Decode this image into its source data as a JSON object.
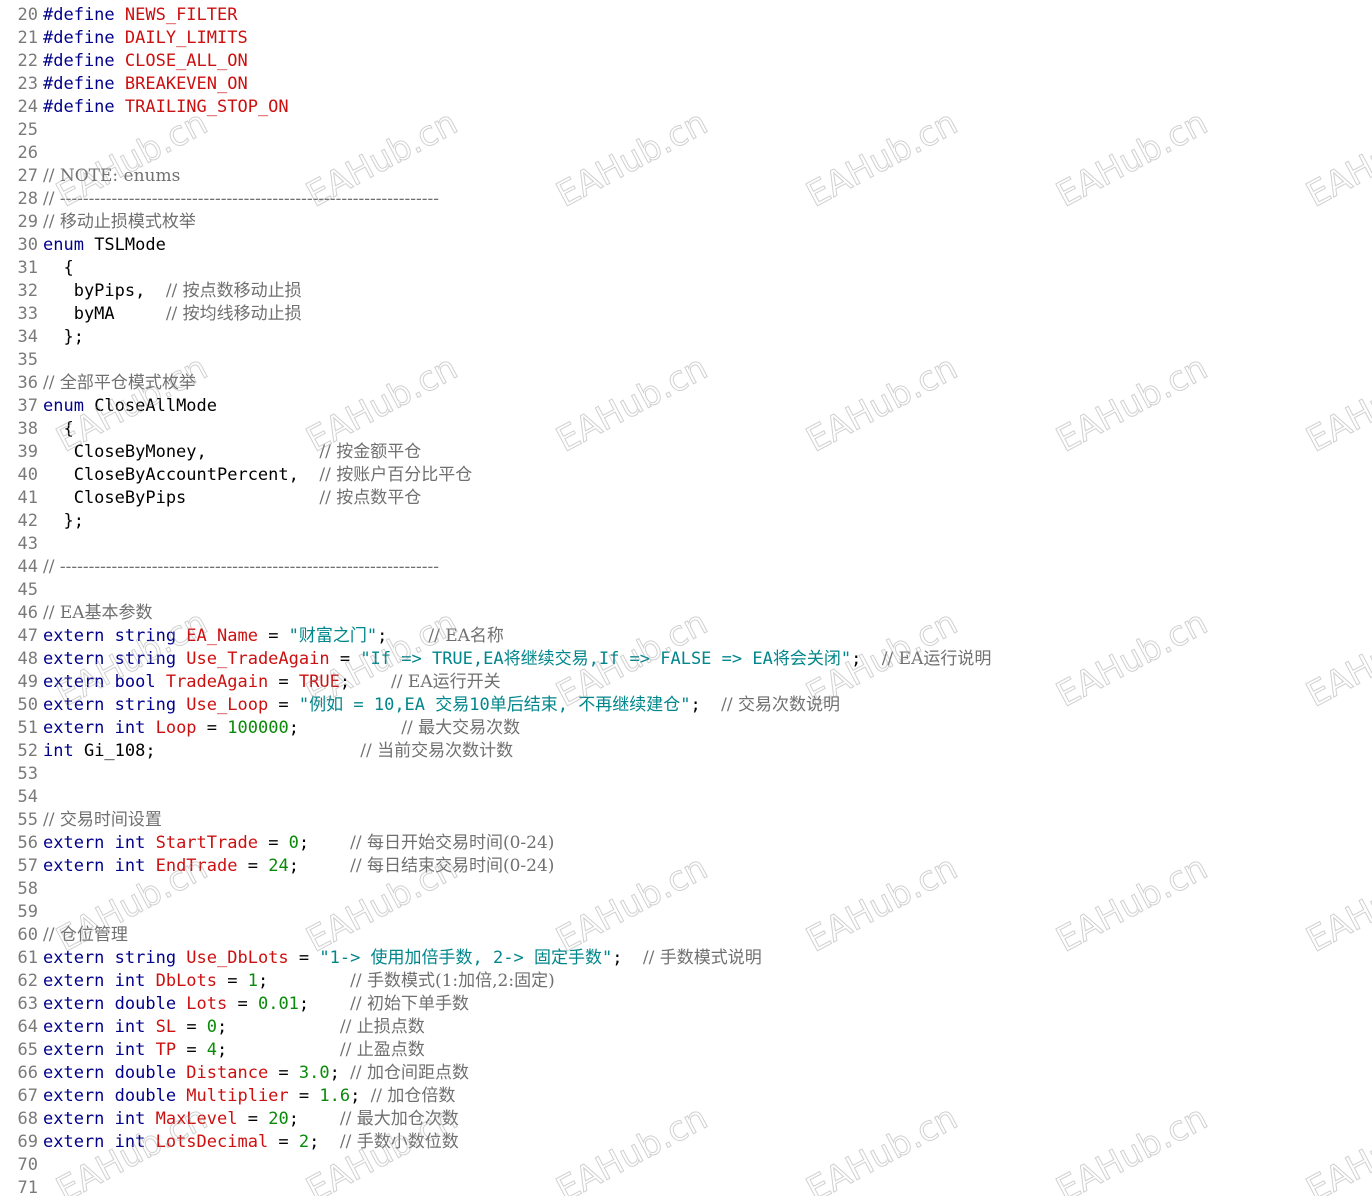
{
  "editor": {
    "lines": [
      {
        "num": "20",
        "tokens": [
          {
            "t": "kw",
            "s": "#define "
          },
          {
            "t": "id",
            "s": "NEWS_FILTER"
          }
        ]
      },
      {
        "num": "21",
        "tokens": [
          {
            "t": "kw",
            "s": "#define "
          },
          {
            "t": "id",
            "s": "DAILY_LIMITS"
          }
        ]
      },
      {
        "num": "22",
        "tokens": [
          {
            "t": "kw",
            "s": "#define "
          },
          {
            "t": "id",
            "s": "CLOSE_ALL_ON"
          }
        ]
      },
      {
        "num": "23",
        "tokens": [
          {
            "t": "kw",
            "s": "#define "
          },
          {
            "t": "id",
            "s": "BREAKEVEN_ON"
          }
        ]
      },
      {
        "num": "24",
        "tokens": [
          {
            "t": "kw",
            "s": "#define "
          },
          {
            "t": "id",
            "s": "TRAILING_STOP_ON"
          }
        ]
      },
      {
        "num": "25",
        "tokens": []
      },
      {
        "num": "26",
        "tokens": []
      },
      {
        "num": "27",
        "tokens": [
          {
            "t": "cmt",
            "s": "// NOTE: enums"
          }
        ]
      },
      {
        "num": "28",
        "tokens": [
          {
            "t": "cmt",
            "s": "// ------------------------------------------------------------------"
          }
        ]
      },
      {
        "num": "29",
        "tokens": [
          {
            "t": "cmt",
            "s": "// 移动止损模式枚举"
          }
        ]
      },
      {
        "num": "30",
        "tokens": [
          {
            "t": "kw",
            "s": "enum "
          },
          {
            "t": "plain",
            "s": "TSLMode"
          }
        ]
      },
      {
        "num": "31",
        "tokens": [
          {
            "t": "plain",
            "s": "  {"
          }
        ]
      },
      {
        "num": "32",
        "tokens": [
          {
            "t": "plain",
            "s": "   byPips,  "
          },
          {
            "t": "cmt",
            "s": "// 按点数移动止损"
          }
        ]
      },
      {
        "num": "33",
        "tokens": [
          {
            "t": "plain",
            "s": "   byMA     "
          },
          {
            "t": "cmt",
            "s": "// 按均线移动止损"
          }
        ]
      },
      {
        "num": "34",
        "tokens": [
          {
            "t": "plain",
            "s": "  };"
          }
        ]
      },
      {
        "num": "35",
        "tokens": []
      },
      {
        "num": "36",
        "tokens": [
          {
            "t": "cmt",
            "s": "// 全部平仓模式枚举"
          }
        ]
      },
      {
        "num": "37",
        "tokens": [
          {
            "t": "kw",
            "s": "enum "
          },
          {
            "t": "plain",
            "s": "CloseAllMode"
          }
        ]
      },
      {
        "num": "38",
        "tokens": [
          {
            "t": "plain",
            "s": "  {"
          }
        ]
      },
      {
        "num": "39",
        "tokens": [
          {
            "t": "plain",
            "s": "   CloseByMoney,           "
          },
          {
            "t": "cmt",
            "s": "// 按金额平仓"
          }
        ]
      },
      {
        "num": "40",
        "tokens": [
          {
            "t": "plain",
            "s": "   CloseByAccountPercent,  "
          },
          {
            "t": "cmt",
            "s": "// 按账户百分比平仓"
          }
        ]
      },
      {
        "num": "41",
        "tokens": [
          {
            "t": "plain",
            "s": "   CloseByPips             "
          },
          {
            "t": "cmt",
            "s": "// 按点数平仓"
          }
        ]
      },
      {
        "num": "42",
        "tokens": [
          {
            "t": "plain",
            "s": "  };"
          }
        ]
      },
      {
        "num": "43",
        "tokens": []
      },
      {
        "num": "44",
        "tokens": [
          {
            "t": "cmt",
            "s": "// ------------------------------------------------------------------"
          }
        ]
      },
      {
        "num": "45",
        "tokens": []
      },
      {
        "num": "46",
        "tokens": [
          {
            "t": "cmt",
            "s": "// EA基本参数"
          }
        ]
      },
      {
        "num": "47",
        "tokens": [
          {
            "t": "kw",
            "s": "extern string "
          },
          {
            "t": "id",
            "s": "EA_Name"
          },
          {
            "t": "plain",
            "s": " = "
          },
          {
            "t": "str",
            "s": "\"财富之门\""
          },
          {
            "t": "plain",
            "s": ";    "
          },
          {
            "t": "cmt",
            "s": "// EA名称"
          }
        ]
      },
      {
        "num": "48",
        "tokens": [
          {
            "t": "kw",
            "s": "extern string "
          },
          {
            "t": "id",
            "s": "Use_TradeAgain"
          },
          {
            "t": "plain",
            "s": " = "
          },
          {
            "t": "str",
            "s": "\"If => TRUE,EA将继续交易,If => FALSE => EA将会关闭\""
          },
          {
            "t": "plain",
            "s": ";  "
          },
          {
            "t": "cmt",
            "s": "// EA运行说明"
          }
        ]
      },
      {
        "num": "49",
        "tokens": [
          {
            "t": "kw",
            "s": "extern bool "
          },
          {
            "t": "id",
            "s": "TradeAgain"
          },
          {
            "t": "plain",
            "s": " = "
          },
          {
            "t": "id",
            "s": "TRUE"
          },
          {
            "t": "plain",
            "s": ";    "
          },
          {
            "t": "cmt",
            "s": "// EA运行开关"
          }
        ]
      },
      {
        "num": "50",
        "tokens": [
          {
            "t": "kw",
            "s": "extern string "
          },
          {
            "t": "id",
            "s": "Use_Loop"
          },
          {
            "t": "plain",
            "s": " = "
          },
          {
            "t": "str",
            "s": "\"例如 = 10,EA 交易10单后结束, 不再继续建仓\""
          },
          {
            "t": "plain",
            "s": ";  "
          },
          {
            "t": "cmt",
            "s": "// 交易次数说明"
          }
        ]
      },
      {
        "num": "51",
        "tokens": [
          {
            "t": "kw",
            "s": "extern int "
          },
          {
            "t": "id",
            "s": "Loop"
          },
          {
            "t": "plain",
            "s": " = "
          },
          {
            "t": "num",
            "s": "100000"
          },
          {
            "t": "plain",
            "s": ";          "
          },
          {
            "t": "cmt",
            "s": "// 最大交易次数"
          }
        ]
      },
      {
        "num": "52",
        "tokens": [
          {
            "t": "kw",
            "s": "int "
          },
          {
            "t": "plain",
            "s": "Gi_108;                    "
          },
          {
            "t": "cmt",
            "s": "// 当前交易次数计数"
          }
        ]
      },
      {
        "num": "53",
        "tokens": []
      },
      {
        "num": "54",
        "tokens": []
      },
      {
        "num": "55",
        "tokens": [
          {
            "t": "cmt",
            "s": "// 交易时间设置"
          }
        ]
      },
      {
        "num": "56",
        "tokens": [
          {
            "t": "kw",
            "s": "extern int "
          },
          {
            "t": "id",
            "s": "StartTrade"
          },
          {
            "t": "plain",
            "s": " = "
          },
          {
            "t": "num",
            "s": "0"
          },
          {
            "t": "plain",
            "s": ";    "
          },
          {
            "t": "cmt",
            "s": "// 每日开始交易时间(0-24)"
          }
        ]
      },
      {
        "num": "57",
        "tokens": [
          {
            "t": "kw",
            "s": "extern int "
          },
          {
            "t": "id",
            "s": "EndTrade"
          },
          {
            "t": "plain",
            "s": " = "
          },
          {
            "t": "num",
            "s": "24"
          },
          {
            "t": "plain",
            "s": ";     "
          },
          {
            "t": "cmt",
            "s": "// 每日结束交易时间(0-24)"
          }
        ]
      },
      {
        "num": "58",
        "tokens": []
      },
      {
        "num": "59",
        "tokens": []
      },
      {
        "num": "60",
        "tokens": [
          {
            "t": "cmt",
            "s": "// 仓位管理"
          }
        ]
      },
      {
        "num": "61",
        "tokens": [
          {
            "t": "kw",
            "s": "extern string "
          },
          {
            "t": "id",
            "s": "Use_DbLots"
          },
          {
            "t": "plain",
            "s": " = "
          },
          {
            "t": "str",
            "s": "\"1-> 使用加倍手数, 2-> 固定手数\""
          },
          {
            "t": "plain",
            "s": ";  "
          },
          {
            "t": "cmt",
            "s": "// 手数模式说明"
          }
        ]
      },
      {
        "num": "62",
        "tokens": [
          {
            "t": "kw",
            "s": "extern int "
          },
          {
            "t": "id",
            "s": "DbLots"
          },
          {
            "t": "plain",
            "s": " = "
          },
          {
            "t": "num",
            "s": "1"
          },
          {
            "t": "plain",
            "s": ";        "
          },
          {
            "t": "cmt",
            "s": "// 手数模式(1:加倍,2:固定)"
          }
        ]
      },
      {
        "num": "63",
        "tokens": [
          {
            "t": "kw",
            "s": "extern double "
          },
          {
            "t": "id",
            "s": "Lots"
          },
          {
            "t": "plain",
            "s": " = "
          },
          {
            "t": "num",
            "s": "0.01"
          },
          {
            "t": "plain",
            "s": ";    "
          },
          {
            "t": "cmt",
            "s": "// 初始下单手数"
          }
        ]
      },
      {
        "num": "64",
        "tokens": [
          {
            "t": "kw",
            "s": "extern int "
          },
          {
            "t": "id",
            "s": "SL"
          },
          {
            "t": "plain",
            "s": " = "
          },
          {
            "t": "num",
            "s": "0"
          },
          {
            "t": "plain",
            "s": ";           "
          },
          {
            "t": "cmt",
            "s": "// 止损点数"
          }
        ]
      },
      {
        "num": "65",
        "tokens": [
          {
            "t": "kw",
            "s": "extern int "
          },
          {
            "t": "id",
            "s": "TP"
          },
          {
            "t": "plain",
            "s": " = "
          },
          {
            "t": "num",
            "s": "4"
          },
          {
            "t": "plain",
            "s": ";           "
          },
          {
            "t": "cmt",
            "s": "// 止盈点数"
          }
        ]
      },
      {
        "num": "66",
        "tokens": [
          {
            "t": "kw",
            "s": "extern double "
          },
          {
            "t": "id",
            "s": "Distance"
          },
          {
            "t": "plain",
            "s": " = "
          },
          {
            "t": "num",
            "s": "3.0"
          },
          {
            "t": "plain",
            "s": "; "
          },
          {
            "t": "cmt",
            "s": "// 加仓间距点数"
          }
        ]
      },
      {
        "num": "67",
        "tokens": [
          {
            "t": "kw",
            "s": "extern double "
          },
          {
            "t": "id",
            "s": "Multiplier"
          },
          {
            "t": "plain",
            "s": " = "
          },
          {
            "t": "num",
            "s": "1.6"
          },
          {
            "t": "plain",
            "s": "; "
          },
          {
            "t": "cmt",
            "s": "// 加仓倍数"
          }
        ]
      },
      {
        "num": "68",
        "tokens": [
          {
            "t": "kw",
            "s": "extern int "
          },
          {
            "t": "id",
            "s": "MaxLevel"
          },
          {
            "t": "plain",
            "s": " = "
          },
          {
            "t": "num",
            "s": "20"
          },
          {
            "t": "plain",
            "s": ";    "
          },
          {
            "t": "cmt",
            "s": "// 最大加仓次数"
          }
        ]
      },
      {
        "num": "69",
        "tokens": [
          {
            "t": "kw",
            "s": "extern int "
          },
          {
            "t": "id",
            "s": "LotsDecimal"
          },
          {
            "t": "plain",
            "s": " = "
          },
          {
            "t": "num",
            "s": "2"
          },
          {
            "t": "plain",
            "s": ";  "
          },
          {
            "t": "cmt",
            "s": "// 手数小数位数"
          }
        ]
      },
      {
        "num": "70",
        "tokens": []
      },
      {
        "num": "71",
        "tokens": []
      }
    ]
  },
  "watermark": {
    "text": "EAHub.cn"
  },
  "colors": {
    "keyword": "#00008b",
    "identifier": "#cc1010",
    "string": "#00868b",
    "number": "#0a8a0a",
    "comment": "#707070",
    "line_number": "#7a7a7a"
  }
}
